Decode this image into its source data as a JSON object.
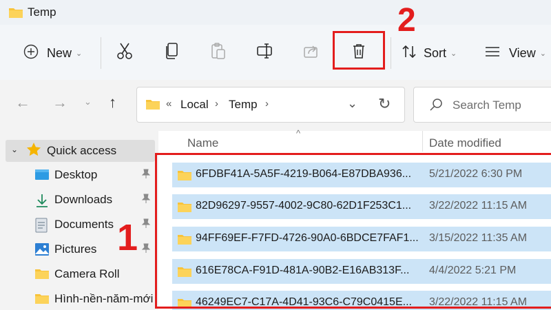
{
  "window": {
    "title": "Temp"
  },
  "toolbar": {
    "new_label": "New",
    "sort_label": "Sort",
    "view_label": "View",
    "annotation_delete": "2"
  },
  "address": {
    "overflow": "«",
    "crumbs": [
      "Local",
      "Temp"
    ],
    "search_placeholder": "Search Temp"
  },
  "sidebar": {
    "quick_access": "Quick access",
    "items": [
      {
        "label": "Desktop",
        "icon": "desktop-icon",
        "pinned": true
      },
      {
        "label": "Downloads",
        "icon": "download-icon",
        "pinned": true
      },
      {
        "label": "Documents",
        "icon": "document-icon",
        "pinned": true
      },
      {
        "label": "Pictures",
        "icon": "pictures-icon",
        "pinned": true
      },
      {
        "label": "Camera Roll",
        "icon": "folder-icon",
        "pinned": false
      },
      {
        "label": "Hình-nền-năm-mới",
        "icon": "folder-icon",
        "pinned": false
      }
    ],
    "annotation_files": "1"
  },
  "files": {
    "columns": {
      "name": "Name",
      "date": "Date modified"
    },
    "rows": [
      {
        "name": "6FDBF41A-5A5F-4219-B064-E87DBA936...",
        "date": "5/21/2022 6:30 PM"
      },
      {
        "name": "82D96297-9557-4002-9C80-62D1F253C1...",
        "date": "3/22/2022 11:15 AM"
      },
      {
        "name": "94FF69EF-F7FD-4726-90A0-6BDCE7FAF1...",
        "date": "3/15/2022 11:35 AM"
      },
      {
        "name": "616E78CA-F91D-481A-90B2-E16AB313F...",
        "date": "4/4/2022 5:21 PM"
      },
      {
        "name": "46249EC7-C17A-4D41-93C6-C79C0415E...",
        "date": "3/22/2022 11:15 AM"
      }
    ]
  },
  "colors": {
    "accent_selection": "#cce4f7",
    "annotation_red": "#e31d1d",
    "folder_yellow": "#f8c33a"
  }
}
